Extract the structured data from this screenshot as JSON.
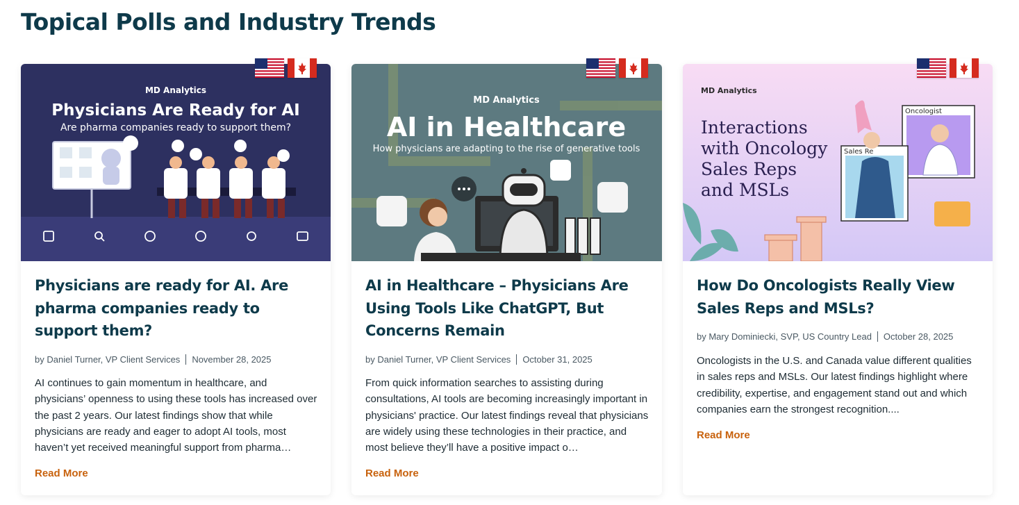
{
  "section": {
    "title": "Topical Polls and Industry Trends"
  },
  "colors": {
    "heading": "#0e3a4a",
    "accent": "#c8620d",
    "text": "#1d2b33",
    "meta": "#4a5963"
  },
  "cards": [
    {
      "image": {
        "brand": "MD Analytics",
        "headline": "Physicians Are Ready for AI",
        "subhead": "Are pharma companies ready to support them?",
        "icons": [
          "edit-icon",
          "search-icon",
          "brain-icon",
          "chart-icon",
          "flower-icon",
          "folder-icon"
        ]
      },
      "flags": [
        "us-flag-icon",
        "canada-flag-icon"
      ],
      "title": "Physicians are ready for AI. Are pharma companies ready to support them?",
      "author": "by Daniel Turner, VP Client Services",
      "date": "November 28, 2025",
      "excerpt": "AI continues to gain momentum in healthcare, and physicians’ openness to using these tools has increased over the past 2 years. Our latest findings show that while physicians are ready and eager to adopt AI tools, most haven’t yet received meaningful support from pharma…",
      "read_more": "Read More"
    },
    {
      "image": {
        "brand": "MD Analytics",
        "headline": "AI in Healthcare",
        "subhead": "How physicians are adapting to the rise of generative tools"
      },
      "flags": [
        "us-flag-icon",
        "canada-flag-icon"
      ],
      "title": "AI in Healthcare – Physicians Are Using Tools Like ChatGPT, But Concerns Remain",
      "author": "by Daniel Turner, VP Client Services",
      "date": "October 31, 2025",
      "excerpt": "From quick information searches to assisting during consultations, AI tools are becoming increasingly important in physicians' practice. Our latest findings reveal that physicians are widely using these technologies in their practice, and most believe they’ll have a positive impact o…",
      "read_more": "Read More"
    },
    {
      "image": {
        "brand": "MD Analytics",
        "headline_lines": [
          "Interactions",
          "with Oncology",
          "Sales Reps",
          "and MSLs"
        ],
        "window_oncologist": "Oncologist",
        "window_sales": "Sales Re"
      },
      "flags": [
        "us-flag-icon",
        "canada-flag-icon"
      ],
      "title": "How Do Oncologists Really View Sales Reps and MSLs?",
      "author": "by Mary Dominiecki, SVP, US Country Lead",
      "date": "October 28, 2025",
      "excerpt": "Oncologists in the U.S. and Canada value different qualities in sales reps and MSLs. Our latest findings highlight where credibility, expertise, and engagement stand out and which companies earn the strongest recognition....",
      "read_more": "Read More"
    }
  ]
}
